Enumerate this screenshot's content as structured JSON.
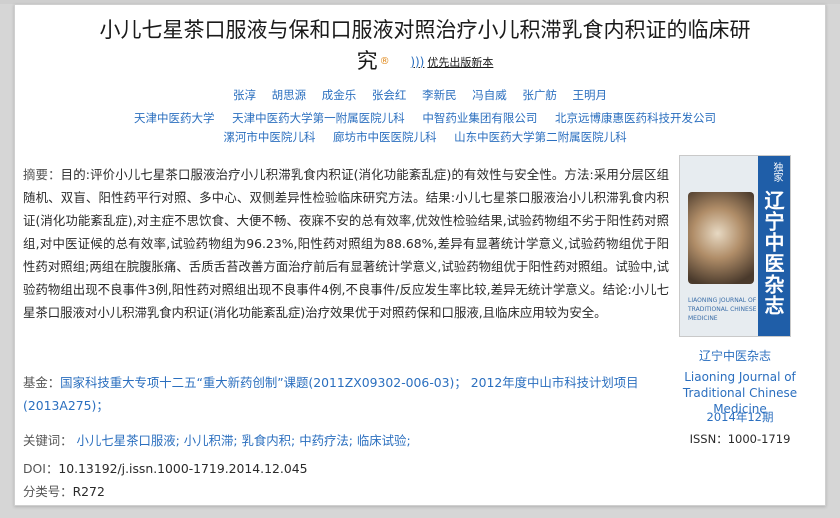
{
  "article": {
    "title_line1": "小儿七星茶口服液与保和口服液对照治疗小儿积滞乳食内积证的临床研",
    "title_line2": "究",
    "rss_label": "优先出版新本",
    "authors": [
      "张淳",
      "胡思源",
      "成金乐",
      "张会红",
      "李新民",
      "冯自威",
      "张广舫",
      "王明月"
    ],
    "organizations": [
      "天津中医药大学",
      "天津中医药大学第一附属医院儿科",
      "中智药业集团有限公司",
      "北京远博康惠医药科技开发公司",
      "漯河市中医院儿科",
      "廊坊市中医医院儿科",
      "山东中医药大学第二附属医院儿科"
    ],
    "abstract_label": "摘要：",
    "abstract": "目的:评价小儿七星茶口服液治疗小儿积滞乳食内积证(消化功能紊乱症)的有效性与安全性。方法:采用分层区组随机、双盲、阳性药平行对照、多中心、双侧差异性检验临床研究方法。结果:小儿七星茶口服液治小儿积滞乳食内积证(消化功能紊乱症),对主症不思饮食、大便不畅、夜寐不安的总有效率,优效性检验结果,试验药物组不劣于阳性药对照组,对中医证候的总有效率,试验药物组为96.23%,阳性药对照组为88.68%,差异有显著统计学意义,试验药物组优于阳性药对照组;两组在脘腹胀痛、舌质舌苔改善方面治疗前后有显著统计学意义,试验药物组优于阳性药对照组。试验中,试验药物组出现不良事件3例,阳性药对照组出现不良事件4例,不良事件/反应发生率比较,差异无统计学意义。结论:小儿七星茶口服液对小儿积滞乳食内积证(消化功能紊乱症)治疗效果优于对照药保和口服液,且临床应用较为安全。",
    "fund_label": "基金：",
    "fund_text": "国家科技重大专项十二五“重大新药创制”课题(2011ZX09302-006-03)；  2012年度中山市科技计划项目(2013A275)；",
    "keywords_label": "关键词：",
    "keywords": [
      "小儿七星茶口服液;",
      "小儿积滞;",
      "乳食内积;",
      "中药疗法;",
      "临床试验;"
    ],
    "doi_label": "DOI：",
    "doi": "10.13192/j.issn.1000-1719.2014.12.045",
    "class_label": "分类号：",
    "class_code": "R272"
  },
  "journal": {
    "cover_tag": "独家",
    "cover_title": "辽宁中医杂志",
    "cover_english": "LIAONING JOURNAL OF TRADITIONAL CHINESE MEDICINE",
    "name": "辽宁中医杂志",
    "english_name": "Liaoning Journal of Traditional Chinese Medicine",
    "issue": "2014年12期",
    "issn": "ISSN：1000-1719"
  },
  "colors": {
    "link": "#2b6fbf",
    "text": "#2a2a2a",
    "accent_r": "#e08a1e"
  }
}
